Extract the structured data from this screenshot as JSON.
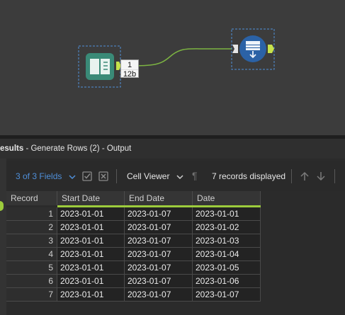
{
  "canvas": {
    "anchor": {
      "top": "1",
      "bottom": "12b"
    }
  },
  "results": {
    "title_bold": "esults",
    "title_rest": " - Generate Rows (2) - Output"
  },
  "toolbar": {
    "fields_label": "3 of 3 Fields",
    "cell_viewer_label": "Cell Viewer",
    "records_label": "7 records displayed"
  },
  "table": {
    "headers": {
      "record": "Record",
      "start": "Start Date",
      "end": "End Date",
      "date": "Date"
    },
    "rows": [
      {
        "record": "1",
        "start": "2023-01-01",
        "end": "2023-01-07",
        "date": "2023-01-01"
      },
      {
        "record": "2",
        "start": "2023-01-01",
        "end": "2023-01-07",
        "date": "2023-01-02"
      },
      {
        "record": "3",
        "start": "2023-01-01",
        "end": "2023-01-07",
        "date": "2023-01-03"
      },
      {
        "record": "4",
        "start": "2023-01-01",
        "end": "2023-01-07",
        "date": "2023-01-04"
      },
      {
        "record": "5",
        "start": "2023-01-01",
        "end": "2023-01-07",
        "date": "2023-01-05"
      },
      {
        "record": "6",
        "start": "2023-01-01",
        "end": "2023-01-07",
        "date": "2023-01-06"
      },
      {
        "record": "7",
        "start": "2023-01-01",
        "end": "2023-01-07",
        "date": "2023-01-07"
      }
    ]
  },
  "colors": {
    "accent_green": "#9ccc3c",
    "link_blue": "#4f8fd9",
    "tool_teal": "#3a8a77",
    "tool_blue": "#2b62a6"
  }
}
